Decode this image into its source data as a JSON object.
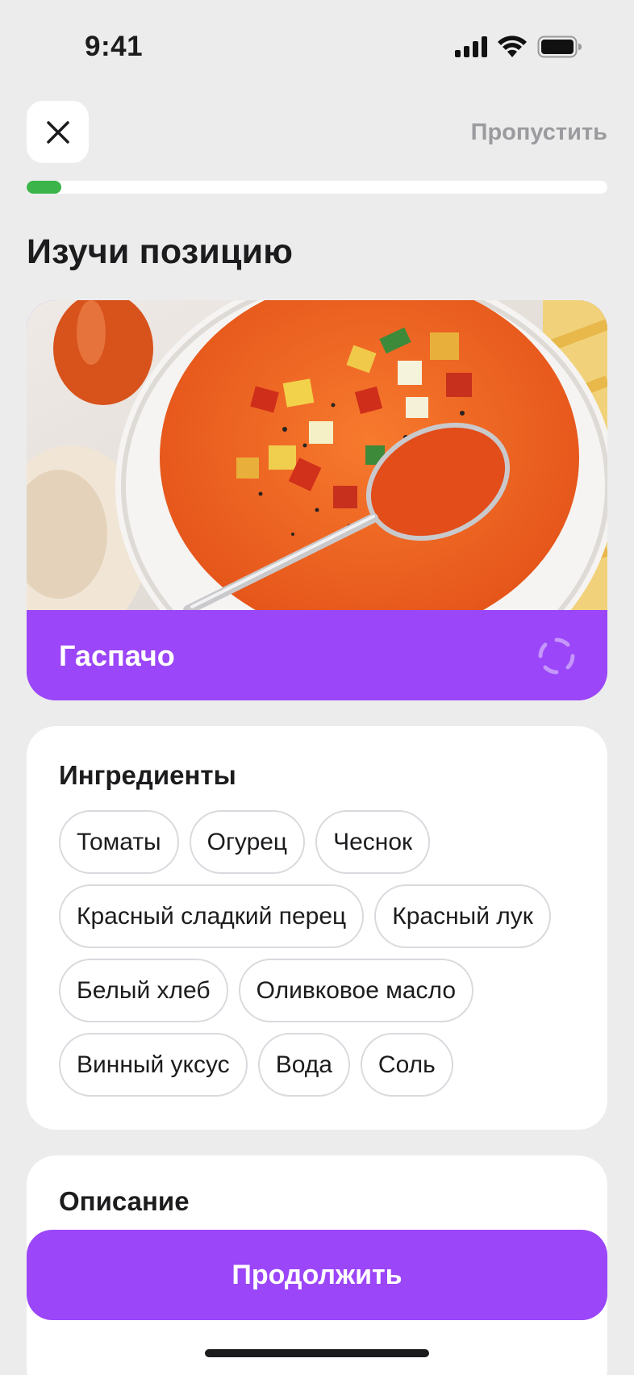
{
  "status_bar": {
    "time": "9:41"
  },
  "header": {
    "close_icon": "close-icon",
    "skip_label": "Пропустить",
    "progress_fraction": 0.06
  },
  "page": {
    "title": "Изучи позицию"
  },
  "dish": {
    "name": "Гаспачо",
    "photo_icon": "gazpacho-photo",
    "spinner_icon": "loading-spinner-icon"
  },
  "ingredients": {
    "title": "Ингредиенты",
    "items": [
      "Томаты",
      "Огурец",
      "Чеснок",
      "Красный сладкий перец",
      "Красный лук",
      "Белый хлеб",
      "Оливковое масло",
      "Винный уксус",
      "Вода",
      "Соль"
    ]
  },
  "description": {
    "title": "Описание"
  },
  "footer": {
    "continue_label": "Продолжить"
  },
  "colors": {
    "accent": "#9b46f8",
    "progress": "#3bb54a",
    "background": "#ececec",
    "muted_text": "#9b9b9f"
  }
}
